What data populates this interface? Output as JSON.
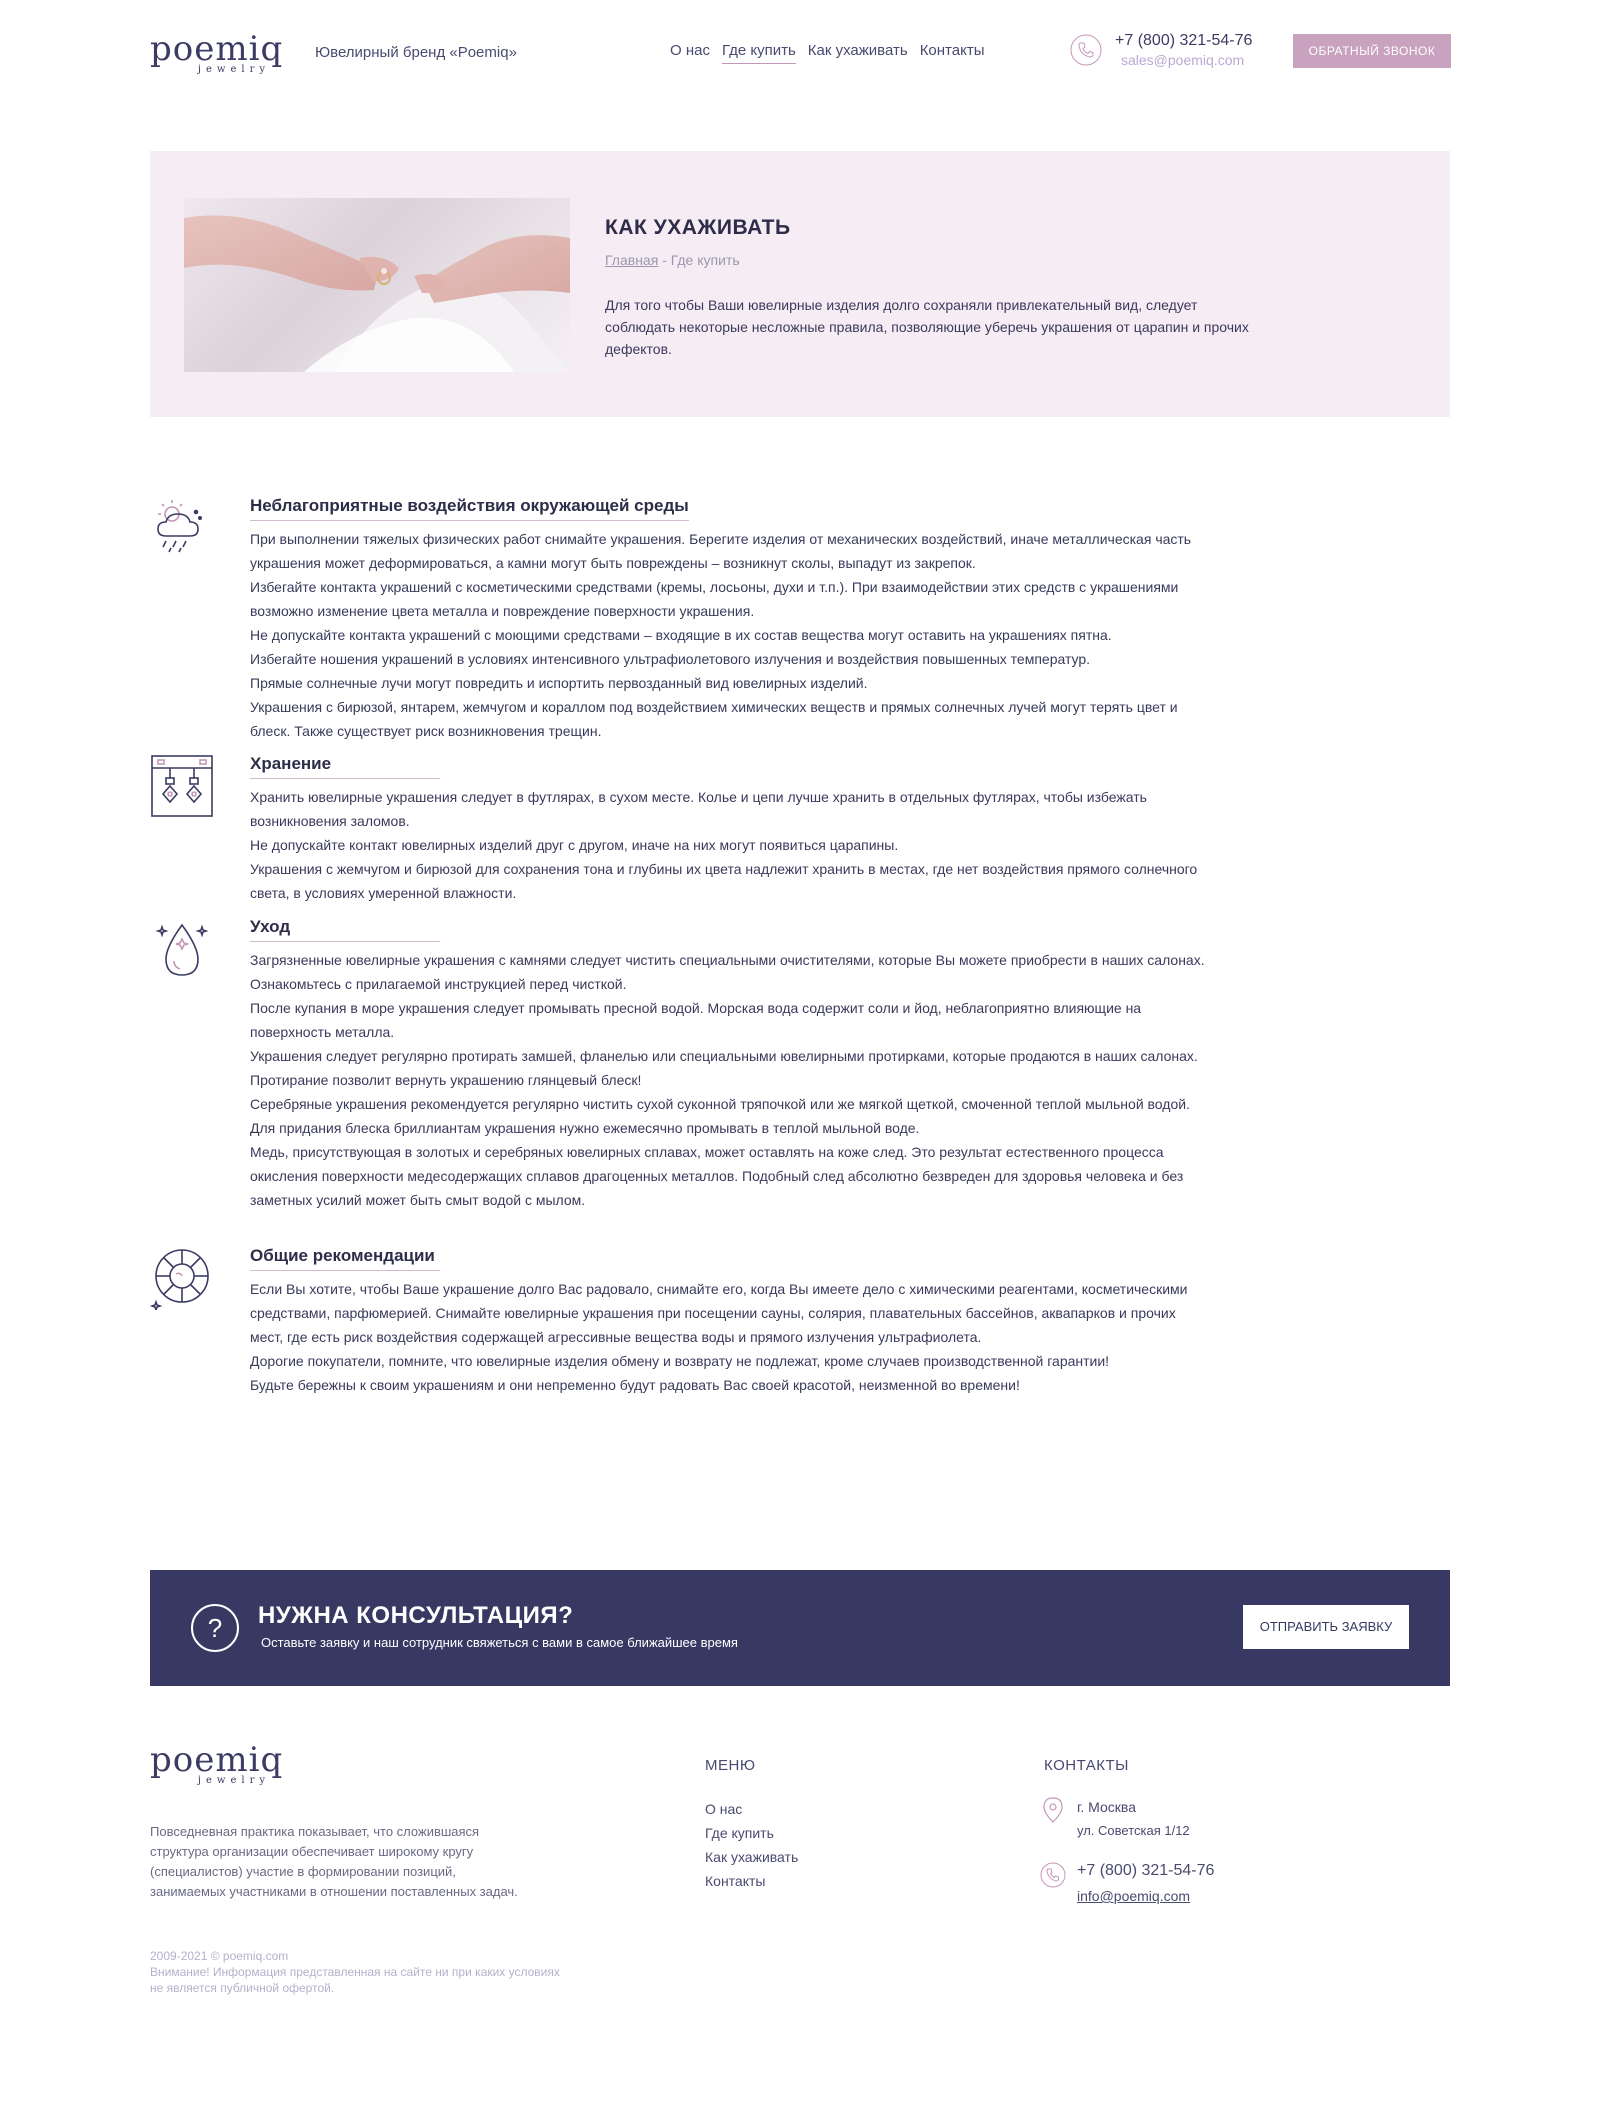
{
  "header": {
    "logo_word": "poemiq",
    "logo_sub": "jewelry",
    "brand_tagline": "Ювелирный бренд «Poemiq»",
    "nav": [
      {
        "label": "О нас"
      },
      {
        "label": "Где купить"
      },
      {
        "label": "Как ухаживать"
      },
      {
        "label": "Контакты"
      }
    ],
    "phone": "+7 (800) 321-54-76",
    "email": "sales@poemiq.com",
    "callback_label": "ОБРАТНЫЙ ЗВОНОК"
  },
  "hero": {
    "title": "КАК УХАЖИВАТЬ",
    "breadcrumb_home": "Главная",
    "breadcrumb_current": "- Где купить",
    "text": "Для того чтобы Ваши ювелирные изделия долго сохраняли привлекательный вид, следует соблюдать некоторые несложные правила, позволяющие уберечь украшения от царапин и прочих дефектов."
  },
  "sections": [
    {
      "title": "Неблагоприятные воздействия окружающей среды",
      "icon": "weather-icon",
      "paragraphs": [
        "При выполнении тяжелых физических работ снимайте украшения. Берегите изделия от механических воздействий, иначе металлическая часть украшения может деформироваться, а камни могут быть повреждены – возникнут сколы, выпадут из закрепок.",
        "Избегайте контакта украшений с косметическими средствами (кремы, лосьоны, духи и т.п.). При взаимодействии этих средств с украшениями возможно изменение цвета металла и повреждение поверхности украшения.",
        "Не допускайте контакта украшений с моющими средствами – входящие в их состав вещества могут оставить на украшениях пятна.",
        "Избегайте ношения украшений в условиях интенсивного ультрафиолетового излучения и воздействия повышенных температур.",
        "Прямые солнечные лучи могут повредить и испортить первозданный вид ювелирных изделий.",
        "Украшения с бирюзой, янтарем, жемчугом и кораллом под воздействием химических веществ и прямых солнечных лучей могут терять цвет и блеск. Также существует риск возникновения трещин."
      ]
    },
    {
      "title": "Хранение",
      "icon": "jewelry-box-icon",
      "paragraphs": [
        "Хранить ювелирные украшения следует в футлярах, в сухом месте. Колье и цепи лучше хранить в отдельных футлярах, чтобы избежать возникновения заломов.",
        "Не допускайте контакт ювелирных изделий друг с другом, иначе на них могут появиться царапины.",
        "Украшения с жемчугом и бирюзой для сохранения тона и глубины их цвета надлежит хранить в местах, где нет воздействия прямого солнечного света, в условиях умеренной влажности."
      ]
    },
    {
      "title": "Уход",
      "icon": "water-drop-icon",
      "paragraphs": [
        "Загрязненные ювелирные украшения с камнями следует чистить специальными очистителями, которые Вы можете приобрести в наших салонах. Ознакомьтесь с прилагаемой инструкцией перед чисткой.",
        "После купания в море украшения следует промывать пресной водой. Морская вода содержит соли и йод, неблагоприятно влияющие на поверхность металла.",
        "Украшения следует регулярно протирать замшей, фланелью или специальными ювелирными протирками, которые продаются в наших салонах. Протирание позволит вернуть украшению глянцевый блеск!",
        "Серебряные украшения рекомендуется регулярно чистить сухой суконной тряпочкой или же мягкой щеткой, смоченной теплой мыльной водой.",
        "Для придания блеска бриллиантам украшения нужно ежемесячно промывать в теплой мыльной воде.",
        "Медь, присутствующая в золотых и серебряных ювелирных сплавах, может оставлять на коже след. Это результат естественного процесса окисления поверхности медесодержащих сплавов драгоценных металлов. Подобный след абсолютно безвреден для здоровья человека и без заметных усилий может быть смыт водой с мылом."
      ]
    },
    {
      "title": "Общие рекомендации",
      "icon": "gem-icon",
      "paragraphs": [
        "Если Вы хотите, чтобы Ваше украшение долго Вас радовало, снимайте его, когда Вы имеете дело с химическими реагентами, косметическими средствами, парфюмерией. Снимайте ювелирные украшения при посещении сауны, солярия, плавательных бассейнов, аквапарков и прочих мест, где есть риск воздействия содержащей агрессивные вещества воды и прямого излучения ультрафиолета.",
        "Дорогие покупатели, помните, что ювелирные изделия обмену и возврату не подлежат, кроме случаев производственной гарантии!",
        "Будьте бережны к своим украшениям и они непременно будут радовать Вас своей красотой, неизменной во времени!"
      ]
    }
  ],
  "consult": {
    "title": "НУЖНА КОНСУЛЬТАЦИЯ?",
    "subtitle": "Оставьте заявку и наш сотрудник свяжеться с вами в самое ближайшее время",
    "button": "ОТПРАВИТЬ ЗАЯВКУ"
  },
  "footer": {
    "logo_word": "poemiq",
    "logo_sub": "jewelry",
    "description": "Повседневная практика показывает, что сложившаяся структура организации обеспечивает широкому кругу (специалистов) участие в формировании позиций, занимаемых участниками в отношении поставленных задач.",
    "copyright": "2009-2021 © poemiq.com",
    "disclaimer": "Внимание! Информация представленная на сайте ни при каких условиях не является публичной офертой.",
    "menu_heading": "МЕНЮ",
    "menu": [
      {
        "label": "О нас"
      },
      {
        "label": "Где купить"
      },
      {
        "label": "Как ухаживать"
      },
      {
        "label": "Контакты"
      }
    ],
    "contacts_heading": "КОНТАКТЫ",
    "city": "г. Москва",
    "street": "ул. Советская 1/12",
    "phone": "+7 (800) 321-54-76",
    "email": "info@poemiq.com"
  },
  "colors": {
    "accent_pink": "#c9a2bf",
    "hero_bg": "#f6ecf4",
    "navy": "#373963",
    "icon_pink": "#c497b8",
    "icon_navy": "#3b3b63"
  }
}
